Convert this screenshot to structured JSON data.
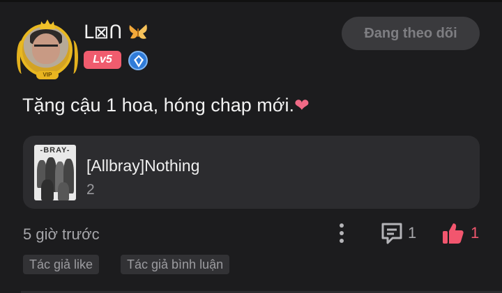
{
  "user": {
    "name": "ᒪ⊠ᑎ",
    "level": "Lv5",
    "avatar_crown_label": "VIP"
  },
  "follow_button": {
    "label": "Đang theo dõi"
  },
  "comment": {
    "text": "Tặng cậu 1 hoa, hóng chap mới.",
    "emoji": "❤"
  },
  "linked_story": {
    "cover_label": "-BRAY-",
    "title": "[Allbray]Nothing",
    "count": "2"
  },
  "footer": {
    "time": "5 giờ trước",
    "comment_count": "1",
    "like_count": "1"
  },
  "tags": [
    "Tác giả like",
    "Tác giả bình luận"
  ],
  "colors": {
    "background": "#1c1c1e",
    "level_badge": "#f05c6e",
    "like": "#f2566e",
    "card": "#2c2c2f"
  }
}
